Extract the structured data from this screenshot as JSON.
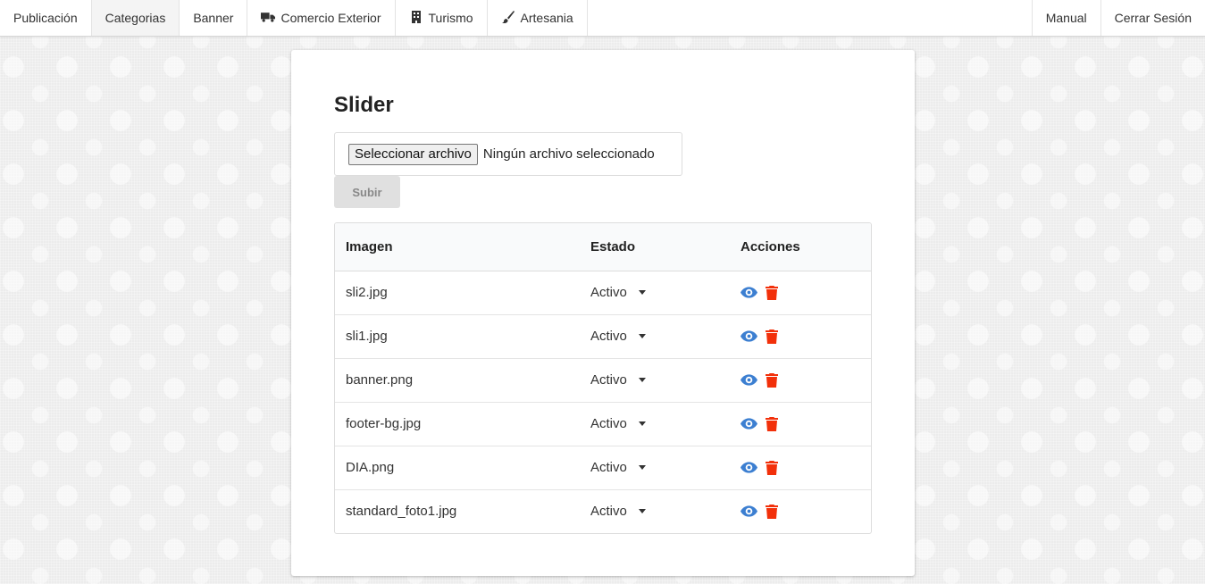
{
  "nav": {
    "left": [
      {
        "label": "Publicación",
        "icon": ""
      },
      {
        "label": "Categorias",
        "icon": ""
      },
      {
        "label": "Banner",
        "icon": ""
      },
      {
        "label": "Comercio Exterior",
        "icon": "truck-icon"
      },
      {
        "label": "Turismo",
        "icon": "building-icon"
      },
      {
        "label": "Artesania",
        "icon": "paint-brush-icon"
      }
    ],
    "right": [
      {
        "label": "Manual"
      },
      {
        "label": "Cerrar Sesión"
      }
    ],
    "active": "Categorias"
  },
  "page": {
    "title": "Slider",
    "file_button": "Seleccionar archivo",
    "file_status": "Ningún archivo seleccionado",
    "upload_label": "Subir"
  },
  "table": {
    "headers": {
      "image": "Imagen",
      "state": "Estado",
      "actions": "Acciones"
    },
    "rows": [
      {
        "image": "sli2.jpg",
        "state": "Activo"
      },
      {
        "image": "sli1.jpg",
        "state": "Activo"
      },
      {
        "image": "banner.png",
        "state": "Activo"
      },
      {
        "image": "footer-bg.jpg",
        "state": "Activo"
      },
      {
        "image": "DIA.png",
        "state": "Activo"
      },
      {
        "image": "standard_foto1.jpg",
        "state": "Activo"
      }
    ]
  },
  "colors": {
    "view_icon": "#3c7fd1",
    "delete_icon": "#f2300a"
  }
}
